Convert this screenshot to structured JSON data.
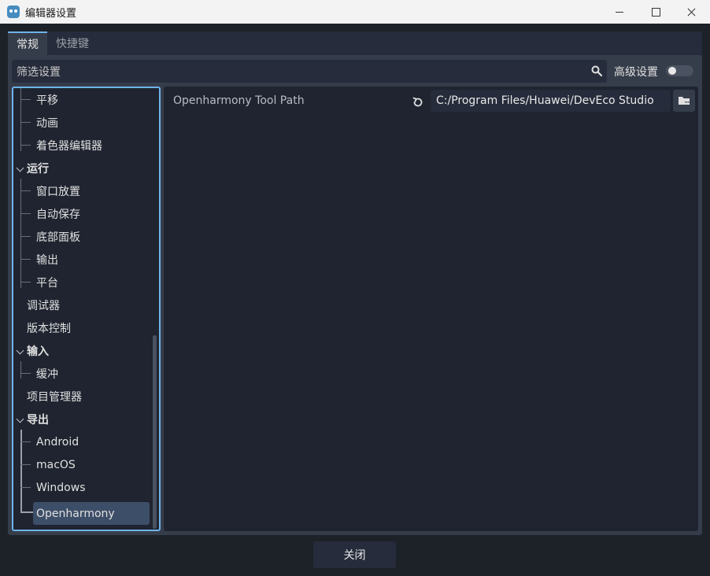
{
  "window": {
    "title": "编辑器设置",
    "controls": {
      "minimize": "minimize",
      "maximize": "maximize",
      "close": "close"
    }
  },
  "tabs": [
    {
      "label": "常规",
      "active": true
    },
    {
      "label": "快捷键",
      "active": false
    }
  ],
  "search": {
    "placeholder": "筛选设置",
    "value": ""
  },
  "advanced": {
    "label": "高级设置",
    "enabled": false
  },
  "tree": {
    "items": [
      {
        "label": "平移",
        "level": 1
      },
      {
        "label": "动画",
        "level": 1
      },
      {
        "label": "着色器编辑器",
        "level": 1
      },
      {
        "label": "运行",
        "level": 0,
        "expanded": true
      },
      {
        "label": "窗口放置",
        "level": 1
      },
      {
        "label": "自动保存",
        "level": 1
      },
      {
        "label": "底部面板",
        "level": 1
      },
      {
        "label": "输出",
        "level": 1
      },
      {
        "label": "平台",
        "level": 1
      },
      {
        "label": "调试器",
        "level": 0
      },
      {
        "label": "版本控制",
        "level": 0
      },
      {
        "label": "输入",
        "level": 0,
        "expanded": true
      },
      {
        "label": "缓冲",
        "level": 1
      },
      {
        "label": "项目管理器",
        "level": 0
      },
      {
        "label": "导出",
        "level": 0,
        "expanded": true
      },
      {
        "label": "Android",
        "level": 1
      },
      {
        "label": "macOS",
        "level": 1
      },
      {
        "label": "Windows",
        "level": 1
      },
      {
        "label": "Openharmony",
        "level": 1,
        "selected": true
      }
    ]
  },
  "inspector": {
    "property": {
      "name": "Openharmony Tool Path",
      "value": "C:/Program Files/Huawei/DevEco Studio"
    }
  },
  "footer": {
    "close_label": "关闭"
  },
  "colors": {
    "accent": "#6fb3ea",
    "background": "#1d2229",
    "panel": "#363d4a",
    "selected": "#3d4e68"
  }
}
